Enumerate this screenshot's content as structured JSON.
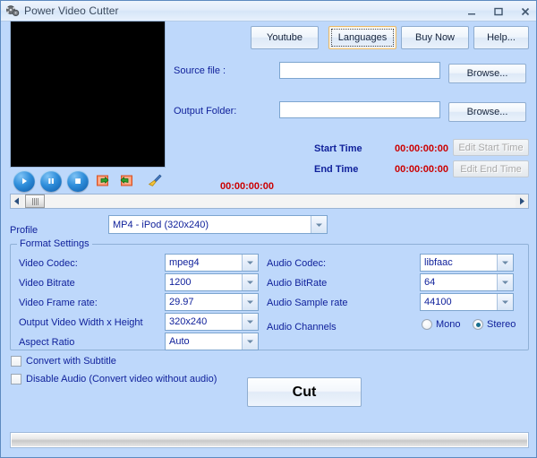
{
  "window": {
    "title": "Power Video Cutter",
    "icon": "film-reel-icon",
    "minimize_label": "–",
    "maximize_label": "□",
    "close_label": "✕",
    "background_color": "#bed8fb"
  },
  "toolbar": {
    "youtube_label": "Youtube",
    "languages_label": "Languages",
    "buy_now_label": "Buy Now",
    "help_label": "Help..."
  },
  "source": {
    "label": "Source file :",
    "value": "",
    "placeholder": "",
    "browse_label": "Browse..."
  },
  "output": {
    "label": "Output Folder:",
    "value": "",
    "placeholder": "",
    "browse_label": "Browse..."
  },
  "times": {
    "start_label": "Start Time",
    "start_value": "00:00:00:00",
    "start_edit_label": "Edit Start Time",
    "end_label": "End Time",
    "end_value": "00:00:00:00",
    "end_edit_label": "Edit End Time",
    "value_color": "#cc0000"
  },
  "player": {
    "play_icon": "play-icon",
    "pause_icon": "pause-icon",
    "stop_icon": "stop-icon",
    "set_start_icon": "set-start-marker-icon",
    "set_end_icon": "set-end-marker-icon",
    "clear_icon": "broom-clear-icon",
    "timecode": "00:00:00:00"
  },
  "timeline": {
    "left_arrow_icon": "arrow-left-icon",
    "right_arrow_icon": "arrow-right-icon",
    "thumb_name": "scrollbar-thumb"
  },
  "profile": {
    "label": "Profile",
    "value": "MP4 - iPod (320x240)"
  },
  "format_settings": {
    "group_title": "Format Settings",
    "video": [
      {
        "label": "Video Codec:",
        "value": "mpeg4"
      },
      {
        "label": "Video Bitrate",
        "value": "1200"
      },
      {
        "label": "Video Frame rate:",
        "value": "29.97"
      },
      {
        "label": "Output Video Width x Height",
        "value": "320x240"
      },
      {
        "label": "Aspect Ratio",
        "value": "Auto"
      }
    ],
    "audio": [
      {
        "label": "Audio Codec:",
        "value": "libfaac"
      },
      {
        "label": "Audio BitRate",
        "value": "64"
      },
      {
        "label": "Audio Sample rate",
        "value": "44100"
      }
    ],
    "audio_channels": {
      "label": "Audio Channels",
      "mono_label": "Mono",
      "stereo_label": "Stereo",
      "selected": "Stereo"
    }
  },
  "options": {
    "subtitle_label": "Convert with Subtitle",
    "subtitle_checked": false,
    "disable_audio_label": "Disable Audio (Convert video without audio)",
    "disable_audio_checked": false
  },
  "action": {
    "cut_label": "Cut"
  },
  "progress": {
    "value": 0
  }
}
